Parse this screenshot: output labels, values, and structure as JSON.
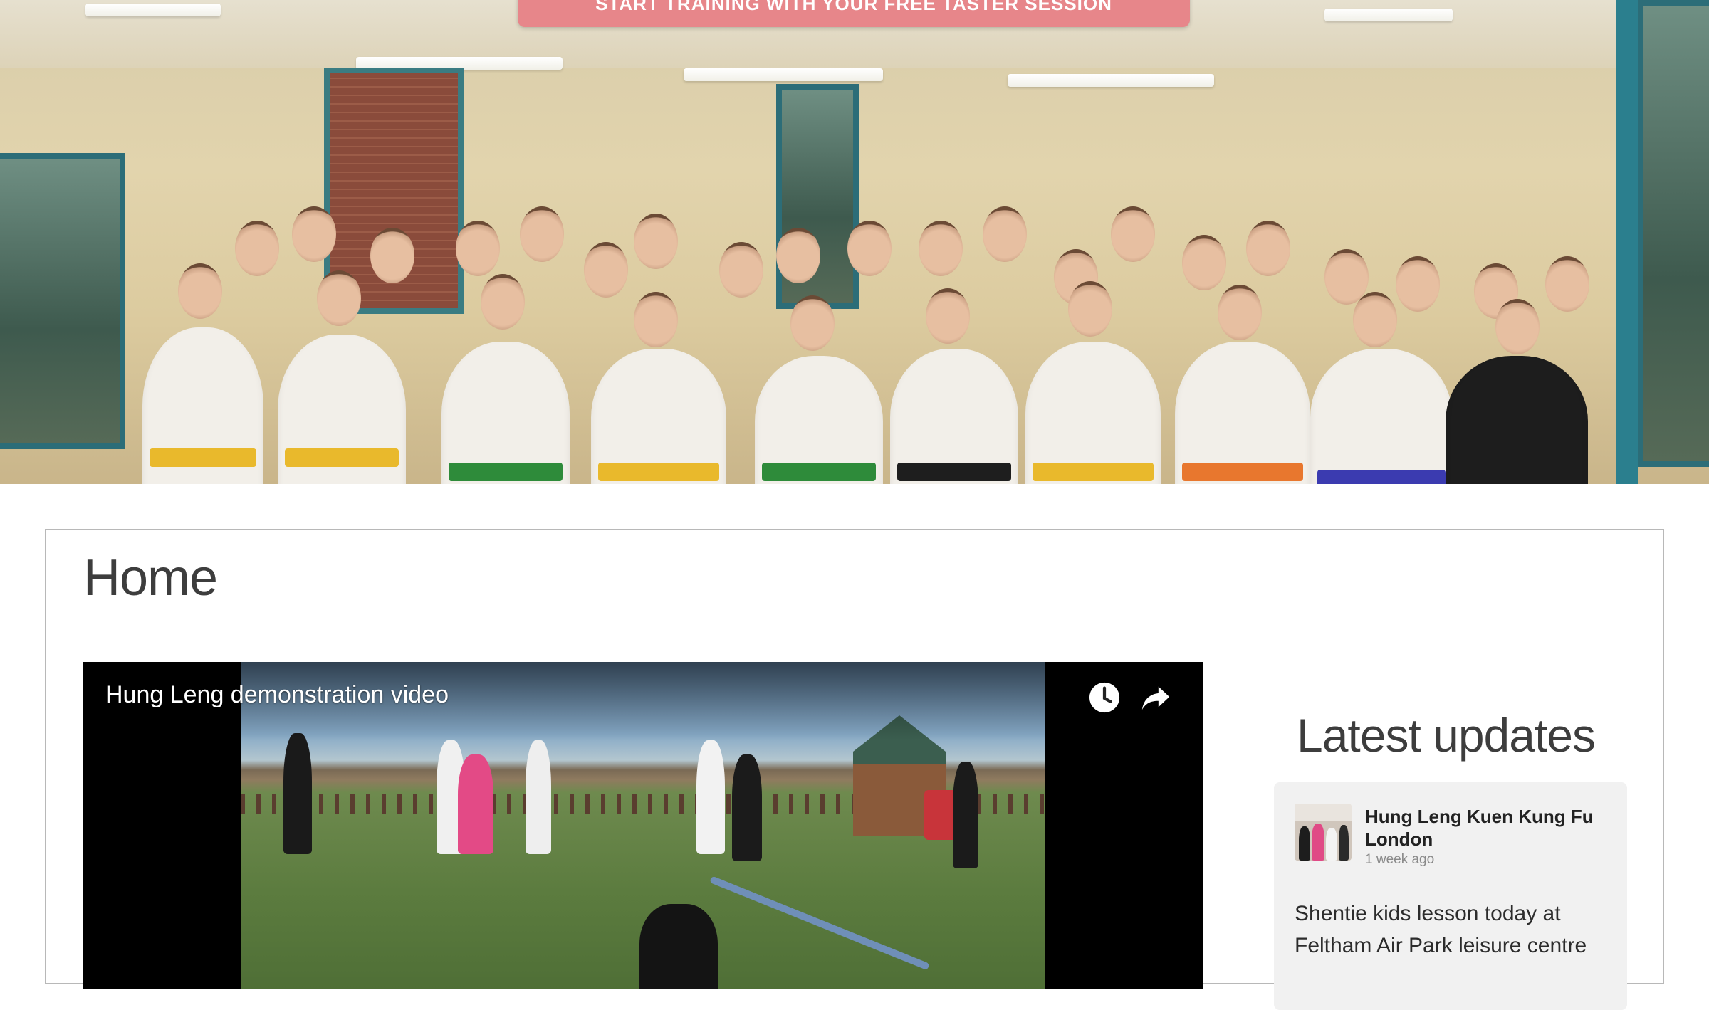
{
  "banner": {
    "text": "START TRAINING WITH YOUR FREE TASTER SESSION",
    "color": "#e7868a"
  },
  "hero": {
    "image_description_icon": "group-photo"
  },
  "page": {
    "title": "Home"
  },
  "video": {
    "title": "Hung Leng demonstration video",
    "watch_later_icon": "clock-icon",
    "share_icon": "share-arrow-icon"
  },
  "sidebar": {
    "title": "Latest updates",
    "posts": [
      {
        "author": "Hung Leng Kuen Kung Fu London",
        "time_ago": "1 week ago",
        "text": "Shentie kids lesson today at Feltham Air Park leisure centre"
      }
    ]
  }
}
